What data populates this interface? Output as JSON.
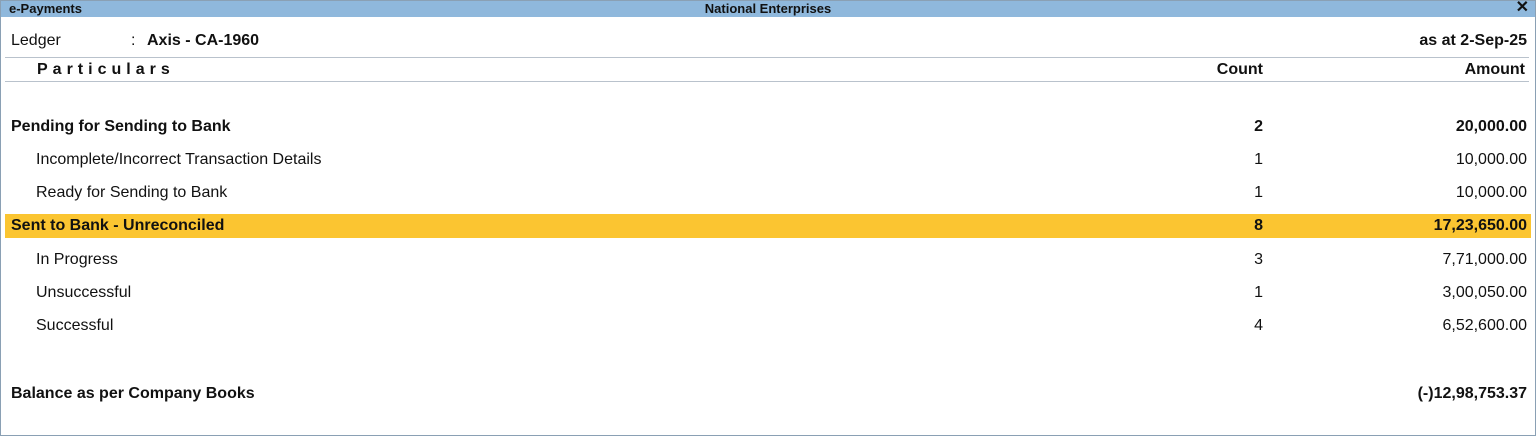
{
  "titlebar": {
    "left": "e-Payments",
    "center": "National Enterprises",
    "close": "✕"
  },
  "ledger": {
    "label": "Ledger",
    "colon": ":",
    "value": "Axis - CA-1960",
    "as_at": "as at 2-Sep-25"
  },
  "header": {
    "particulars": "Particulars",
    "count": "Count",
    "amount": "Amount"
  },
  "rows": [
    {
      "type": "group",
      "name": "Pending for Sending to Bank",
      "count": "2",
      "amount": "20,000.00"
    },
    {
      "type": "sub",
      "name": "Incomplete/Incorrect Transaction Details",
      "count": "1",
      "amount": "10,000.00"
    },
    {
      "type": "sub",
      "name": "Ready for Sending to Bank",
      "count": "1",
      "amount": "10,000.00"
    },
    {
      "type": "group",
      "name": "Sent to Bank - Unreconciled",
      "count": "8",
      "amount": "17,23,650.00",
      "selected": true
    },
    {
      "type": "sub",
      "name": "In Progress",
      "count": "3",
      "amount": "7,71,000.00"
    },
    {
      "type": "sub",
      "name": "Unsuccessful",
      "count": "1",
      "amount": "3,00,050.00"
    },
    {
      "type": "sub",
      "name": "Successful",
      "count": "4",
      "amount": "6,52,600.00"
    }
  ],
  "balance": {
    "name": "Balance as per Company Books",
    "amount": "(-)12,98,753.37"
  },
  "colors": {
    "titlebar": "#8fb8dc",
    "selection": "#fbc531"
  }
}
